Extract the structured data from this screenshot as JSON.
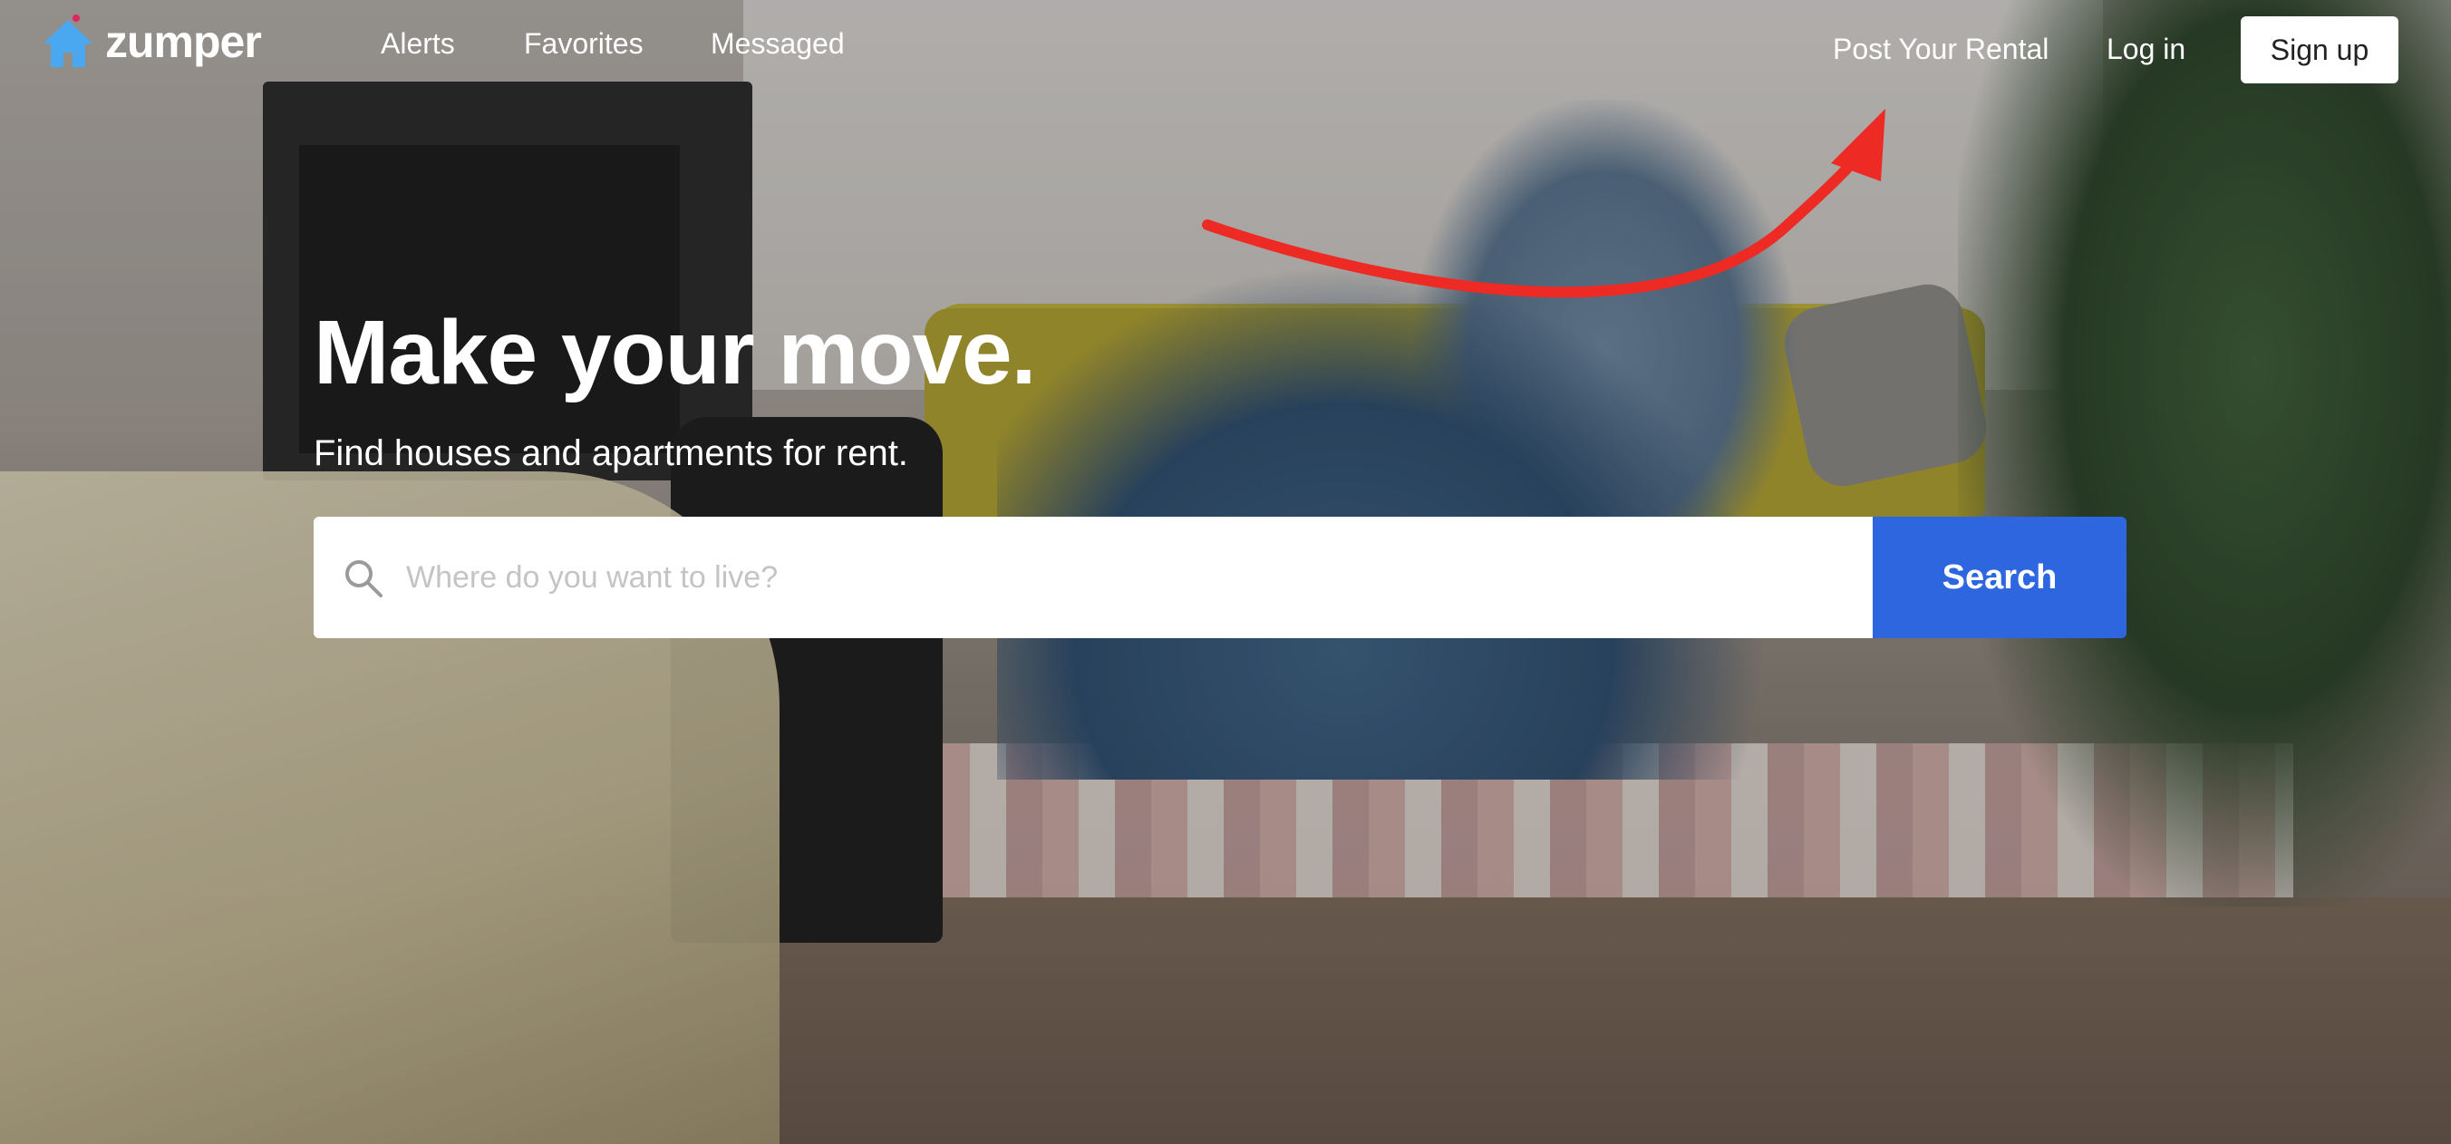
{
  "brand": {
    "name": "zumper",
    "logo_color": "#4aa8f0",
    "accent_dot": "#e0265e"
  },
  "nav": {
    "alerts": "Alerts",
    "favorites": "Favorites",
    "messaged": "Messaged",
    "post_rental": "Post Your Rental",
    "login": "Log in",
    "signup": "Sign up"
  },
  "hero": {
    "title": "Make your move.",
    "subtitle": "Find houses and apartments for rent."
  },
  "search": {
    "placeholder": "Where do you want to live?",
    "value": "",
    "button_label": "Search",
    "button_color": "#2e66e0"
  },
  "annotation": {
    "icon": "red-arrow-icon",
    "color": "#ee2a24",
    "points_to": "Post Your Rental"
  }
}
